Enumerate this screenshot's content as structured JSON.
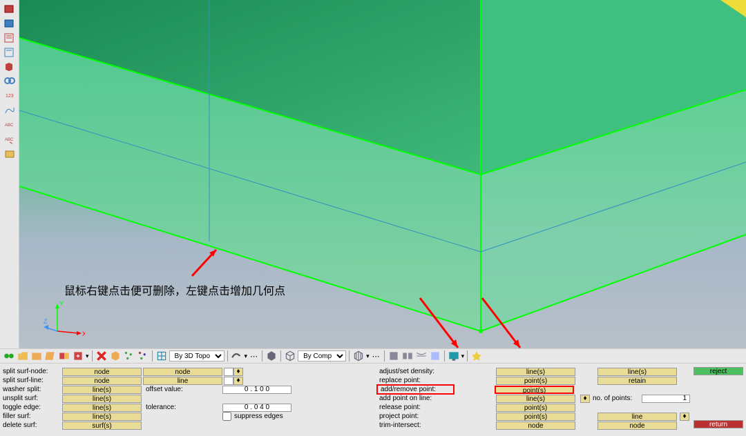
{
  "instruction": "鼠标右键点击便可删除，左键点击增加几何点",
  "toolbar": {
    "combo1": "By 3D Topo",
    "combo2": "By Comp"
  },
  "panel": {
    "col1": [
      {
        "label": "split surf-node:",
        "btns": [
          "node",
          "node"
        ],
        "toggle": true
      },
      {
        "label": "split surf-line:",
        "btns": [
          "node",
          "line"
        ],
        "toggle": true
      },
      {
        "label": "washer split:",
        "btns": [
          "line(s)"
        ],
        "extra_label": "offset value:",
        "input": "0 . 1 0 0"
      },
      {
        "label": "unsplit surf:",
        "btns": [
          "line(s)"
        ]
      },
      {
        "label": "toggle edge:",
        "btns": [
          "line(s)"
        ],
        "extra_label": "tolerance:",
        "input": "0 . 0 4 0"
      },
      {
        "label": "filler surf:",
        "btns": [
          "line(s)"
        ],
        "checkbox": "suppress edges"
      },
      {
        "label": "delete surf:",
        "btns": [
          "surf(s)"
        ]
      }
    ],
    "col2": [
      {
        "label": "adjust/set density:",
        "btns": [
          "line(s)",
          "line(s)"
        ]
      },
      {
        "label": "replace point:",
        "btns": [
          "point(s)",
          "retain"
        ]
      },
      {
        "label": "add/remove point:",
        "btns": [
          "point(s)"
        ],
        "highlight": true
      },
      {
        "label": "add point on line:",
        "btns": [
          "line(s)"
        ],
        "extra_label": "no. of points:",
        "input": "1",
        "toggle_after": true
      },
      {
        "label": "release point:",
        "btns": [
          "point(s)"
        ]
      },
      {
        "label": "project point:",
        "btns": [
          "point(s)",
          "line"
        ],
        "toggle": true
      },
      {
        "label": "trim-intersect:",
        "btns": [
          "node",
          "node"
        ]
      }
    ],
    "actions": {
      "reject": "reject",
      "return": "return"
    }
  }
}
